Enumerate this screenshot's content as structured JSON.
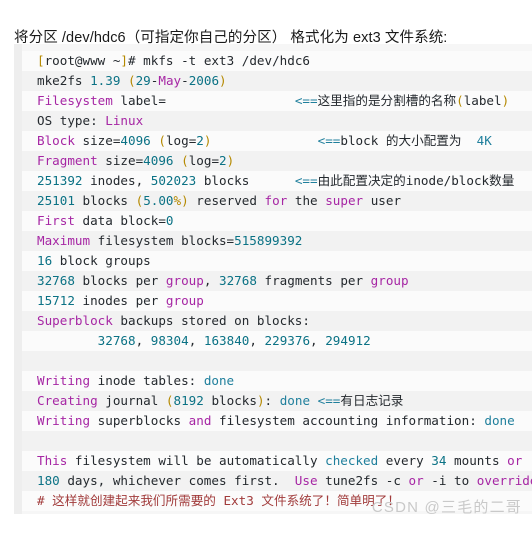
{
  "intro": {
    "text": "将分区 /dev/hdc6（可指定你自己的分区） 格式化为 ext3 文件系统:"
  },
  "code_block": {
    "language": "shell",
    "background_color": "#f6f6f6",
    "stripe_color": "#fbfbfb",
    "colors": {
      "keyword": "#a626a4",
      "number": "#0b7285",
      "string": "#1f7f9c",
      "operator": "#b58900",
      "comment": "#a13b3b",
      "plain": "#24292e"
    },
    "lines": [
      {
        "id": "line-1",
        "tokens": [
          {
            "t": "[",
            "c": "op"
          },
          {
            "t": "root@www ~",
            "c": "pl"
          },
          {
            "t": "]",
            "c": "op"
          },
          {
            "t": "# mkfs -t ext3 /dev/hdc6",
            "c": "pl"
          }
        ]
      },
      {
        "id": "line-2",
        "tokens": [
          {
            "t": "mke2fs ",
            "c": "pl"
          },
          {
            "t": "1.39",
            "c": "num"
          },
          {
            "t": " (",
            "c": "op"
          },
          {
            "t": "29",
            "c": "num"
          },
          {
            "t": "-",
            "c": "pl"
          },
          {
            "t": "May",
            "c": "kw"
          },
          {
            "t": "-",
            "c": "pl"
          },
          {
            "t": "2006",
            "c": "num"
          },
          {
            "t": ")",
            "c": "op"
          }
        ]
      },
      {
        "id": "line-3",
        "tokens": [
          {
            "t": "Filesystem",
            "c": "kw"
          },
          {
            "t": " label=",
            "c": "pl"
          },
          {
            "t": "                 ",
            "c": "pl"
          },
          {
            "t": "<==",
            "c": "str"
          },
          {
            "t": "这里指的是分割槽的名称",
            "c": "zh"
          },
          {
            "t": "(",
            "c": "op"
          },
          {
            "t": "label",
            "c": "pl"
          },
          {
            "t": ")",
            "c": "op"
          }
        ]
      },
      {
        "id": "line-4",
        "tokens": [
          {
            "t": "OS type: ",
            "c": "pl"
          },
          {
            "t": "Linux",
            "c": "kw"
          }
        ]
      },
      {
        "id": "line-5",
        "tokens": [
          {
            "t": "Block",
            "c": "kw"
          },
          {
            "t": " size=",
            "c": "pl"
          },
          {
            "t": "4096",
            "c": "num"
          },
          {
            "t": " (",
            "c": "op"
          },
          {
            "t": "log",
            "c": "pl"
          },
          {
            "t": "=",
            "c": "pl"
          },
          {
            "t": "2",
            "c": "num"
          },
          {
            "t": ")",
            "c": "op"
          },
          {
            "t": "              ",
            "c": "pl"
          },
          {
            "t": "<==",
            "c": "str"
          },
          {
            "t": "block ",
            "c": "zh"
          },
          {
            "t": "的大小配置为",
            "c": "zh"
          },
          {
            "t": "  ",
            "c": "pl"
          },
          {
            "t": "4K",
            "c": "str"
          }
        ]
      },
      {
        "id": "line-6",
        "tokens": [
          {
            "t": "Fragment",
            "c": "kw"
          },
          {
            "t": " size=",
            "c": "pl"
          },
          {
            "t": "4096",
            "c": "num"
          },
          {
            "t": " (",
            "c": "op"
          },
          {
            "t": "log",
            "c": "pl"
          },
          {
            "t": "=",
            "c": "pl"
          },
          {
            "t": "2",
            "c": "num"
          },
          {
            "t": ")",
            "c": "op"
          }
        ]
      },
      {
        "id": "line-7",
        "tokens": [
          {
            "t": "251392",
            "c": "num"
          },
          {
            "t": " inodes, ",
            "c": "pl"
          },
          {
            "t": "502023",
            "c": "num"
          },
          {
            "t": " blocks",
            "c": "pl"
          },
          {
            "t": "      ",
            "c": "pl"
          },
          {
            "t": "<==",
            "c": "str"
          },
          {
            "t": "由此配置决定的inode/block数量",
            "c": "zh"
          }
        ]
      },
      {
        "id": "line-8",
        "tokens": [
          {
            "t": "25101",
            "c": "num"
          },
          {
            "t": " blocks ",
            "c": "pl"
          },
          {
            "t": "(",
            "c": "op"
          },
          {
            "t": "5.00",
            "c": "num"
          },
          {
            "t": "%)",
            "c": "op"
          },
          {
            "t": " reserved ",
            "c": "pl"
          },
          {
            "t": "for",
            "c": "kw"
          },
          {
            "t": " the ",
            "c": "pl"
          },
          {
            "t": "super",
            "c": "kw"
          },
          {
            "t": " user",
            "c": "pl"
          }
        ]
      },
      {
        "id": "line-9",
        "tokens": [
          {
            "t": "First",
            "c": "kw"
          },
          {
            "t": " data block=",
            "c": "pl"
          },
          {
            "t": "0",
            "c": "num"
          }
        ]
      },
      {
        "id": "line-10",
        "tokens": [
          {
            "t": "Maximum",
            "c": "kw"
          },
          {
            "t": " filesystem blocks=",
            "c": "pl"
          },
          {
            "t": "515899392",
            "c": "num"
          }
        ]
      },
      {
        "id": "line-11",
        "tokens": [
          {
            "t": "16",
            "c": "num"
          },
          {
            "t": " block groups",
            "c": "pl"
          }
        ]
      },
      {
        "id": "line-12",
        "tokens": [
          {
            "t": "32768",
            "c": "num"
          },
          {
            "t": " blocks per ",
            "c": "pl"
          },
          {
            "t": "group",
            "c": "kw"
          },
          {
            "t": ", ",
            "c": "pl"
          },
          {
            "t": "32768",
            "c": "num"
          },
          {
            "t": " fragments per ",
            "c": "pl"
          },
          {
            "t": "group",
            "c": "kw"
          }
        ]
      },
      {
        "id": "line-13",
        "tokens": [
          {
            "t": "15712",
            "c": "num"
          },
          {
            "t": " inodes per ",
            "c": "pl"
          },
          {
            "t": "group",
            "c": "kw"
          }
        ]
      },
      {
        "id": "line-14",
        "tokens": [
          {
            "t": "Superblock",
            "c": "kw"
          },
          {
            "t": " backups stored on blocks:",
            "c": "pl"
          }
        ]
      },
      {
        "id": "line-15",
        "tokens": [
          {
            "t": "        ",
            "c": "pl"
          },
          {
            "t": "32768",
            "c": "num"
          },
          {
            "t": ", ",
            "c": "pl"
          },
          {
            "t": "98304",
            "c": "num"
          },
          {
            "t": ", ",
            "c": "pl"
          },
          {
            "t": "163840",
            "c": "num"
          },
          {
            "t": ", ",
            "c": "pl"
          },
          {
            "t": "229376",
            "c": "num"
          },
          {
            "t": ", ",
            "c": "pl"
          },
          {
            "t": "294912",
            "c": "num"
          }
        ]
      },
      {
        "id": "line-16",
        "tokens": []
      },
      {
        "id": "line-17",
        "tokens": [
          {
            "t": "Writing",
            "c": "kw"
          },
          {
            "t": " inode tables: ",
            "c": "pl"
          },
          {
            "t": "done",
            "c": "str"
          }
        ]
      },
      {
        "id": "line-18",
        "tokens": [
          {
            "t": "Creating",
            "c": "kw"
          },
          {
            "t": " journal ",
            "c": "pl"
          },
          {
            "t": "(",
            "c": "op"
          },
          {
            "t": "8192",
            "c": "num"
          },
          {
            "t": " blocks",
            "c": "pl"
          },
          {
            "t": ")",
            "c": "op"
          },
          {
            "t": ": ",
            "c": "pl"
          },
          {
            "t": "done",
            "c": "str"
          },
          {
            "t": " ",
            "c": "pl"
          },
          {
            "t": "<==",
            "c": "str"
          },
          {
            "t": "有日志记录",
            "c": "zh"
          }
        ]
      },
      {
        "id": "line-19",
        "tokens": [
          {
            "t": "Writing",
            "c": "kw"
          },
          {
            "t": " superblocks ",
            "c": "pl"
          },
          {
            "t": "and",
            "c": "kw"
          },
          {
            "t": " filesystem accounting information: ",
            "c": "pl"
          },
          {
            "t": "done",
            "c": "str"
          }
        ]
      },
      {
        "id": "line-20",
        "tokens": []
      },
      {
        "id": "line-21",
        "tokens": [
          {
            "t": "This",
            "c": "kw"
          },
          {
            "t": " filesystem will be automatically ",
            "c": "pl"
          },
          {
            "t": "checked",
            "c": "str"
          },
          {
            "t": " every ",
            "c": "pl"
          },
          {
            "t": "34",
            "c": "num"
          },
          {
            "t": " mounts ",
            "c": "pl"
          },
          {
            "t": "or",
            "c": "kw"
          }
        ]
      },
      {
        "id": "line-22",
        "tokens": [
          {
            "t": "180",
            "c": "num"
          },
          {
            "t": " days, whichever comes first.  ",
            "c": "pl"
          },
          {
            "t": "Use",
            "c": "kw"
          },
          {
            "t": " tune2fs -c ",
            "c": "pl"
          },
          {
            "t": "or",
            "c": "kw"
          },
          {
            "t": " -i to ",
            "c": "pl"
          },
          {
            "t": "override",
            "c": "kw"
          },
          {
            "t": ".",
            "c": "pl"
          }
        ]
      },
      {
        "id": "line-23",
        "tokens": [
          {
            "t": "# 这样就创建起来我们所需要的 Ext3 文件系统了！简单明了！",
            "c": "cmt"
          }
        ]
      }
    ]
  },
  "watermark": {
    "text": "CSDN @三毛的二哥"
  }
}
